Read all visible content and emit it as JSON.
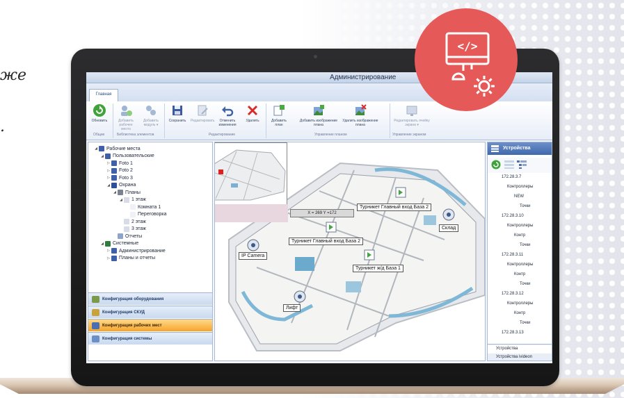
{
  "side_text": {
    "line1": "же",
    "line2": "."
  },
  "window": {
    "title": "Администрирование",
    "tab_main": "Главная"
  },
  "ribbon": {
    "buttons": [
      {
        "label": "Обновить"
      },
      {
        "label": "Добавить рабочее место"
      },
      {
        "label": "Добавить модуль ▾"
      },
      {
        "label": "Сохранить"
      },
      {
        "label": "Редактировать"
      },
      {
        "label": "Отменить изменения"
      },
      {
        "label": "Удалить"
      },
      {
        "label": "Добавить план"
      },
      {
        "label": "Добавить изображение плана"
      },
      {
        "label": "Удалить изображение плана"
      },
      {
        "label": "Редактировать ячейку экрана ▾"
      }
    ],
    "groups": [
      "Общие",
      "Библиотека элементов",
      "Редактирование",
      "Управление планом",
      "Управление экраном"
    ]
  },
  "tree": [
    {
      "label": "Рабочие места",
      "level": 0,
      "exp": "◢"
    },
    {
      "label": "Пользовательские",
      "level": 1,
      "exp": "◢"
    },
    {
      "label": "Foto 1",
      "level": 2,
      "exp": "▷"
    },
    {
      "label": "Foto 2",
      "level": 2,
      "exp": "▷"
    },
    {
      "label": "Foto 3",
      "level": 2,
      "exp": "▷"
    },
    {
      "label": "Охрана",
      "level": 2,
      "exp": "◢"
    },
    {
      "label": "Планы",
      "level": 3,
      "exp": "◢"
    },
    {
      "label": "1 этаж",
      "level": 4,
      "exp": "◢"
    },
    {
      "label": "Комната 1",
      "level": 5,
      "exp": ""
    },
    {
      "label": "Переговорка",
      "level": 5,
      "exp": ""
    },
    {
      "label": "2 этаж",
      "level": 4,
      "exp": ""
    },
    {
      "label": "3 этаж",
      "level": 4,
      "exp": ""
    },
    {
      "label": "Отчеты",
      "level": 3,
      "exp": ""
    },
    {
      "label": "Системные",
      "level": 1,
      "exp": "◢"
    },
    {
      "label": "Администрирование",
      "level": 2,
      "exp": "▷"
    },
    {
      "label": "Планы и отчеты",
      "level": 2,
      "exp": "▷"
    }
  ],
  "nav": [
    {
      "label": "Конфигурация оборудования",
      "active": false
    },
    {
      "label": "Конфигурация СКУД",
      "active": false
    },
    {
      "label": "Конфигурация рабочих мест",
      "active": true
    },
    {
      "label": "Конфигурация системы",
      "active": false
    }
  ],
  "map": {
    "coord": "X = 269 Y =172",
    "labels": [
      {
        "text": "Турникет Главный вход База 2"
      },
      {
        "text": "Склад"
      },
      {
        "text": "Турникет Главный вход База 2"
      },
      {
        "text": "IP Camera"
      },
      {
        "text": "Турникет ж/д База 1"
      },
      {
        "text": "Лифт"
      }
    ]
  },
  "right": {
    "title": "Устройства",
    "nodes": [
      {
        "text": "172.28.3.7",
        "x": 20
      },
      {
        "text": "Контроллеры",
        "x": 28
      },
      {
        "text": "NEW",
        "x": 38
      },
      {
        "text": "Точки",
        "x": 46
      },
      {
        "text": "172.28.3.10",
        "x": 20
      },
      {
        "text": "Контроллеры",
        "x": 28
      },
      {
        "text": "Контр",
        "x": 38
      },
      {
        "text": "Точки",
        "x": 46
      },
      {
        "text": "172.28.3.11",
        "x": 20
      },
      {
        "text": "Контроллеры",
        "x": 28
      },
      {
        "text": "Контр",
        "x": 38
      },
      {
        "text": "Точки",
        "x": 46
      },
      {
        "text": "172.28.3.12",
        "x": 20
      },
      {
        "text": "Контроллеры",
        "x": 28
      },
      {
        "text": "Контр",
        "x": 38
      },
      {
        "text": "Точки",
        "x": 46
      },
      {
        "text": "172.28.3.13",
        "x": 20
      }
    ],
    "tabs": [
      "Устройства",
      "Устройства ivideon"
    ]
  },
  "badge": {
    "icon": "code-monitor-gear-icon",
    "color": "#e55a58"
  }
}
